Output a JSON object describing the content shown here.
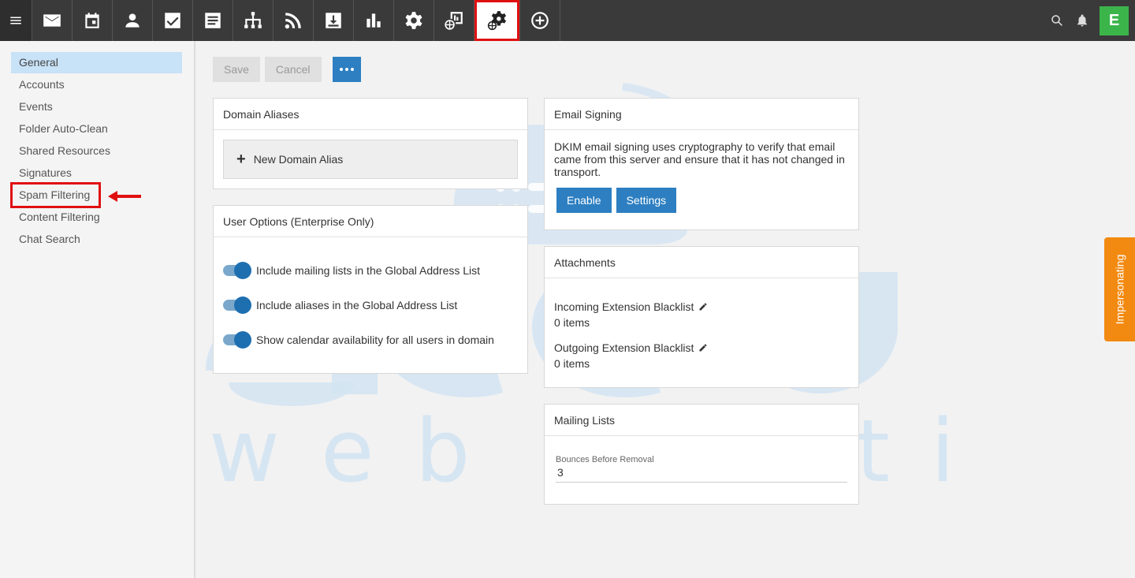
{
  "toolbar": {
    "items": [
      {
        "name": "menu-icon"
      },
      {
        "name": "email-icon"
      },
      {
        "name": "calendar-icon"
      },
      {
        "name": "contacts-icon"
      },
      {
        "name": "tasks-icon"
      },
      {
        "name": "notes-icon"
      },
      {
        "name": "sitemap-icon"
      },
      {
        "name": "rss-icon"
      },
      {
        "name": "download-icon"
      },
      {
        "name": "reports-icon"
      },
      {
        "name": "settings-icon"
      },
      {
        "name": "domain-reports-icon"
      },
      {
        "name": "domain-settings-icon",
        "active": true
      },
      {
        "name": "add-circle-icon"
      }
    ],
    "right": {
      "search": "search-icon",
      "bell": "bell-icon",
      "avatar_initial": "E",
      "avatar_color": "#3bb54a"
    }
  },
  "sidebar": {
    "items": [
      {
        "label": "General",
        "active": true
      },
      {
        "label": "Accounts"
      },
      {
        "label": "Events"
      },
      {
        "label": "Folder Auto-Clean"
      },
      {
        "label": "Shared Resources"
      },
      {
        "label": "Signatures"
      },
      {
        "label": "Spam Filtering",
        "highlighted": true
      },
      {
        "label": "Content Filtering"
      },
      {
        "label": "Chat Search"
      }
    ]
  },
  "actions": {
    "save": "Save",
    "cancel": "Cancel"
  },
  "domain_aliases": {
    "title": "Domain Aliases",
    "new_label": "New Domain Alias"
  },
  "user_options": {
    "title": "User Options (Enterprise Only)",
    "toggles": [
      {
        "label": "Include mailing lists in the Global Address List",
        "on": true
      },
      {
        "label": "Include aliases in the Global Address List",
        "on": true
      },
      {
        "label": "Show calendar availability for all users in domain",
        "on": true
      }
    ]
  },
  "email_signing": {
    "title": "Email Signing",
    "description": "DKIM email signing uses cryptography to verify that email came from this server and ensure that it has not changed in transport.",
    "enable": "Enable",
    "settings": "Settings"
  },
  "attachments": {
    "title": "Attachments",
    "incoming_label": "Incoming Extension Blacklist",
    "incoming_value": "0 items",
    "outgoing_label": "Outgoing Extension Blacklist",
    "outgoing_value": "0 items"
  },
  "mailing_lists": {
    "title": "Mailing Lists",
    "bounces_label": "Bounces Before Removal",
    "bounces_value": "3"
  },
  "impersonating": "Impersonating",
  "watermark": {
    "brand": "accu",
    "tagline": "web hosting"
  },
  "colors": {
    "accent": "#2d7fc1",
    "highlight": "#e01010",
    "impersonate": "#f28a12",
    "active_nav": "#c8e2f7"
  }
}
